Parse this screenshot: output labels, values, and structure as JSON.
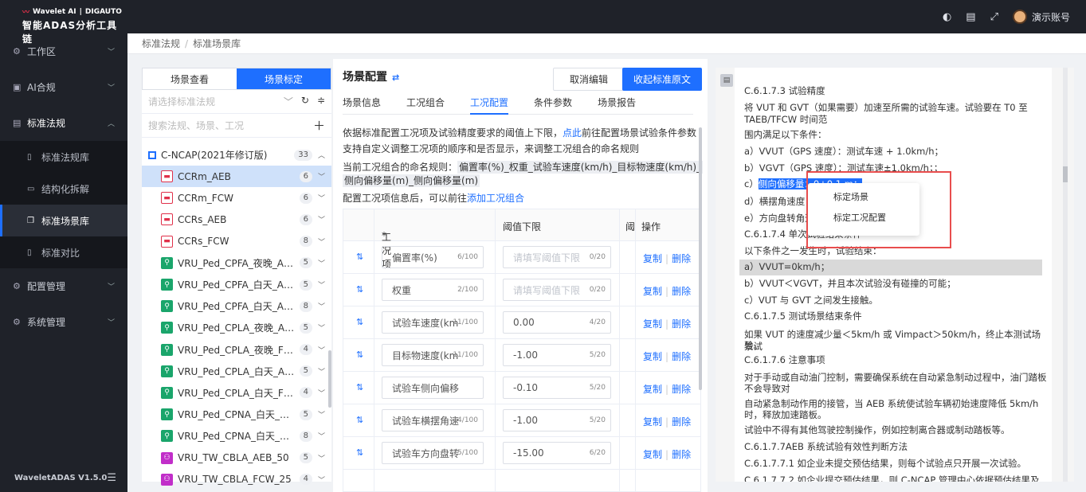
{
  "brand": {
    "name1": "Wavelet AI",
    "name2": "DIGAUTO",
    "title": "智能ADAS分析工具链"
  },
  "sidebar": {
    "menu": [
      {
        "label": "工作区",
        "icon": "gear-icon"
      },
      {
        "label": "AI合规",
        "icon": "ai-icon"
      },
      {
        "label": "标准法规",
        "icon": "doc-icon"
      }
    ],
    "sub": [
      {
        "label": "标准法规库",
        "icon": "book-icon"
      },
      {
        "label": "结构化拆解",
        "icon": "file-icon"
      },
      {
        "label": "标准场景库",
        "icon": "copy-icon"
      },
      {
        "label": "标准对比",
        "icon": "compare-icon"
      }
    ],
    "menu2": [
      {
        "label": "配置管理",
        "icon": "gear-icon"
      },
      {
        "label": "系统管理",
        "icon": "gear-icon"
      }
    ],
    "version": "WaveletADAS  V1.5.0"
  },
  "topbar": {
    "user": "演示账号"
  },
  "breadcrumb": [
    "标准法规",
    "标准场景库"
  ],
  "left": {
    "tabs": [
      "场景查看",
      "场景标定"
    ],
    "select_placeholder": "请选择标准法规",
    "search_placeholder": "搜索法规、场景、工况",
    "tree_head": {
      "label": "C-NCAP(2021年修订版)",
      "count": "33"
    },
    "items": [
      {
        "label": "CCRm_AEB",
        "count": "6",
        "type": "car"
      },
      {
        "label": "CCRm_FCW",
        "count": "6",
        "type": "car"
      },
      {
        "label": "CCRs_AEB",
        "count": "6",
        "type": "car"
      },
      {
        "label": "CCRs_FCW",
        "count": "8",
        "type": "car"
      },
      {
        "label": "VRU_Ped_CPFA_夜晚_AE...",
        "count": "5",
        "type": "ped"
      },
      {
        "label": "VRU_Ped_CPFA_白天_AE...",
        "count": "5",
        "type": "ped"
      },
      {
        "label": "VRU_Ped_CPFA_白天_AE...",
        "count": "8",
        "type": "ped"
      },
      {
        "label": "VRU_Ped_CPLA_夜晚_AE...",
        "count": "5",
        "type": "ped"
      },
      {
        "label": "VRU_Ped_CPLA_夜晚_FC...",
        "count": "4",
        "type": "ped"
      },
      {
        "label": "VRU_Ped_CPLA_白天_AE...",
        "count": "5",
        "type": "ped"
      },
      {
        "label": "VRU_Ped_CPLA_白天_FC...",
        "count": "4",
        "type": "ped"
      },
      {
        "label": "VRU_Ped_CPNA_白天_AE...",
        "count": "5",
        "type": "ped"
      },
      {
        "label": "VRU_Ped_CPNA_白天_AE...",
        "count": "8",
        "type": "ped"
      },
      {
        "label": "VRU_TW_CBLA_AEB_50",
        "count": "5",
        "type": "bike"
      },
      {
        "label": "VRU_TW_CBLA_FCW_25",
        "count": "4",
        "type": "bike"
      }
    ]
  },
  "center": {
    "title": "场景配置",
    "cancel": "取消编辑",
    "collapse": "收起标准原文",
    "tabs": [
      "场景信息",
      "工况组合",
      "工况配置",
      "条件参数",
      "场景报告"
    ],
    "desc1a": "依据标准配置工况项及试验精度要求的阈值上下限，",
    "desc1link": "点此",
    "desc1b": "前往配置场景试验条件参数",
    "desc2": "支持自定义调整工况项的顺序和是否显示，来调整工况组合的命名规则",
    "rule_label": "当前工况组合的命名规则：",
    "rule1": "偏置率(%)_权重_试验车速度(km/h)_目标物速度(km/h)_",
    "rule2": "侧向偏移量(m)_侧向偏移量(m)",
    "desc3a": "配置工况项信息后，可以前往",
    "desc3link": "添加工况组合",
    "headers": {
      "req": "*",
      "item": "工况项",
      "lower": "阈值下限",
      "upper": "阈",
      "op": "操作"
    },
    "lower_placeholder": "请填写阈值下限",
    "copy": "复制",
    "del": "删除",
    "rows": [
      {
        "name": "偏置率(%)",
        "nc": "6/100",
        "val": "",
        "vc": "0/20"
      },
      {
        "name": "权重",
        "nc": "2/100",
        "val": "",
        "vc": "0/20"
      },
      {
        "name": "试验车速度(km",
        "nc": "11/100",
        "val": "0.00",
        "vc": "4/20"
      },
      {
        "name": "目标物速度(km",
        "nc": "11/100",
        "val": "-1.00",
        "vc": "5/20"
      },
      {
        "name": "试验车侧向偏移",
        "nc": "",
        "val": "-0.10",
        "vc": "5/20"
      },
      {
        "name": "试验车横摆角速",
        "nc": "14/100",
        "val": "-1.00",
        "vc": "5/20"
      },
      {
        "name": "试验车方向盘转",
        "nc": "15/100",
        "val": "-15.00",
        "vc": "6/20"
      }
    ]
  },
  "doc": {
    "l1": "C.6.1.7.3 试验精度",
    "l2": "将 VUT 和 GVT（如果需要）加速至所需的试验车速。试验要在 T0 至",
    "l3": "TAEB/TFCW 时间范",
    "l4": "围内满足以下条件：",
    "l5": "a）VVUT（GPS 速度）：测试车速 + 1.0km/h；",
    "l6": "b）VGVT（GPS 速度）：测试车速±1.0km/h；；",
    "l7a": "c）",
    "l7sel": "侧向偏移量：0±0.1 m；",
    "l8": "d）横摆角速度：0±",
    "l9": "e）方向盘转角速度：",
    "l10": "C.6.1.7.4 单次试验结束条件",
    "l11": "以下条件之一发生时，试验结束：",
    "l12": "a）VVUT=0km/h；",
    "l13": "b）VVUT＜VGVT，并且本次试验没有碰撞的可能；",
    "l14": "c）VUT 与 GVT 之间发生接触。",
    "l15": "C.6.1.7.5 测试场景结束条件",
    "l16": "如果 VUT 的速度减少量＜5km/h 或 Vimpact＞50km/h，终止本测试场景试",
    "l17": "验。",
    "l18": "C.6.1.7.6 注意事项",
    "l19": "对于手动或自动油门控制，需要确保系统在自动紧急制动过程中，油门踏板",
    "l20": "不会导致对",
    "l21": "自动紧急制动作用的接管，当 AEB 系统使试验车辆初始速度降低 5km/h",
    "l22": "时，释放加速踏板。",
    "l23": "试验中不得有其他驾驶控制操作，例如控制离合器或制动踏板等。",
    "l24": "C.6.1.7.7AEB 系统试验有效性判断方法",
    "l25": "C.6.1.7.7.1 如企业未提交预估结果，则每个试验点只开展一次试验。",
    "l26": "C.6.1.7.7.2 如企业提交预估结果，则 C-NCAP 管理中心依据预估结果及现"
  },
  "context_menu": [
    "标定场景",
    "标定工况配置"
  ]
}
